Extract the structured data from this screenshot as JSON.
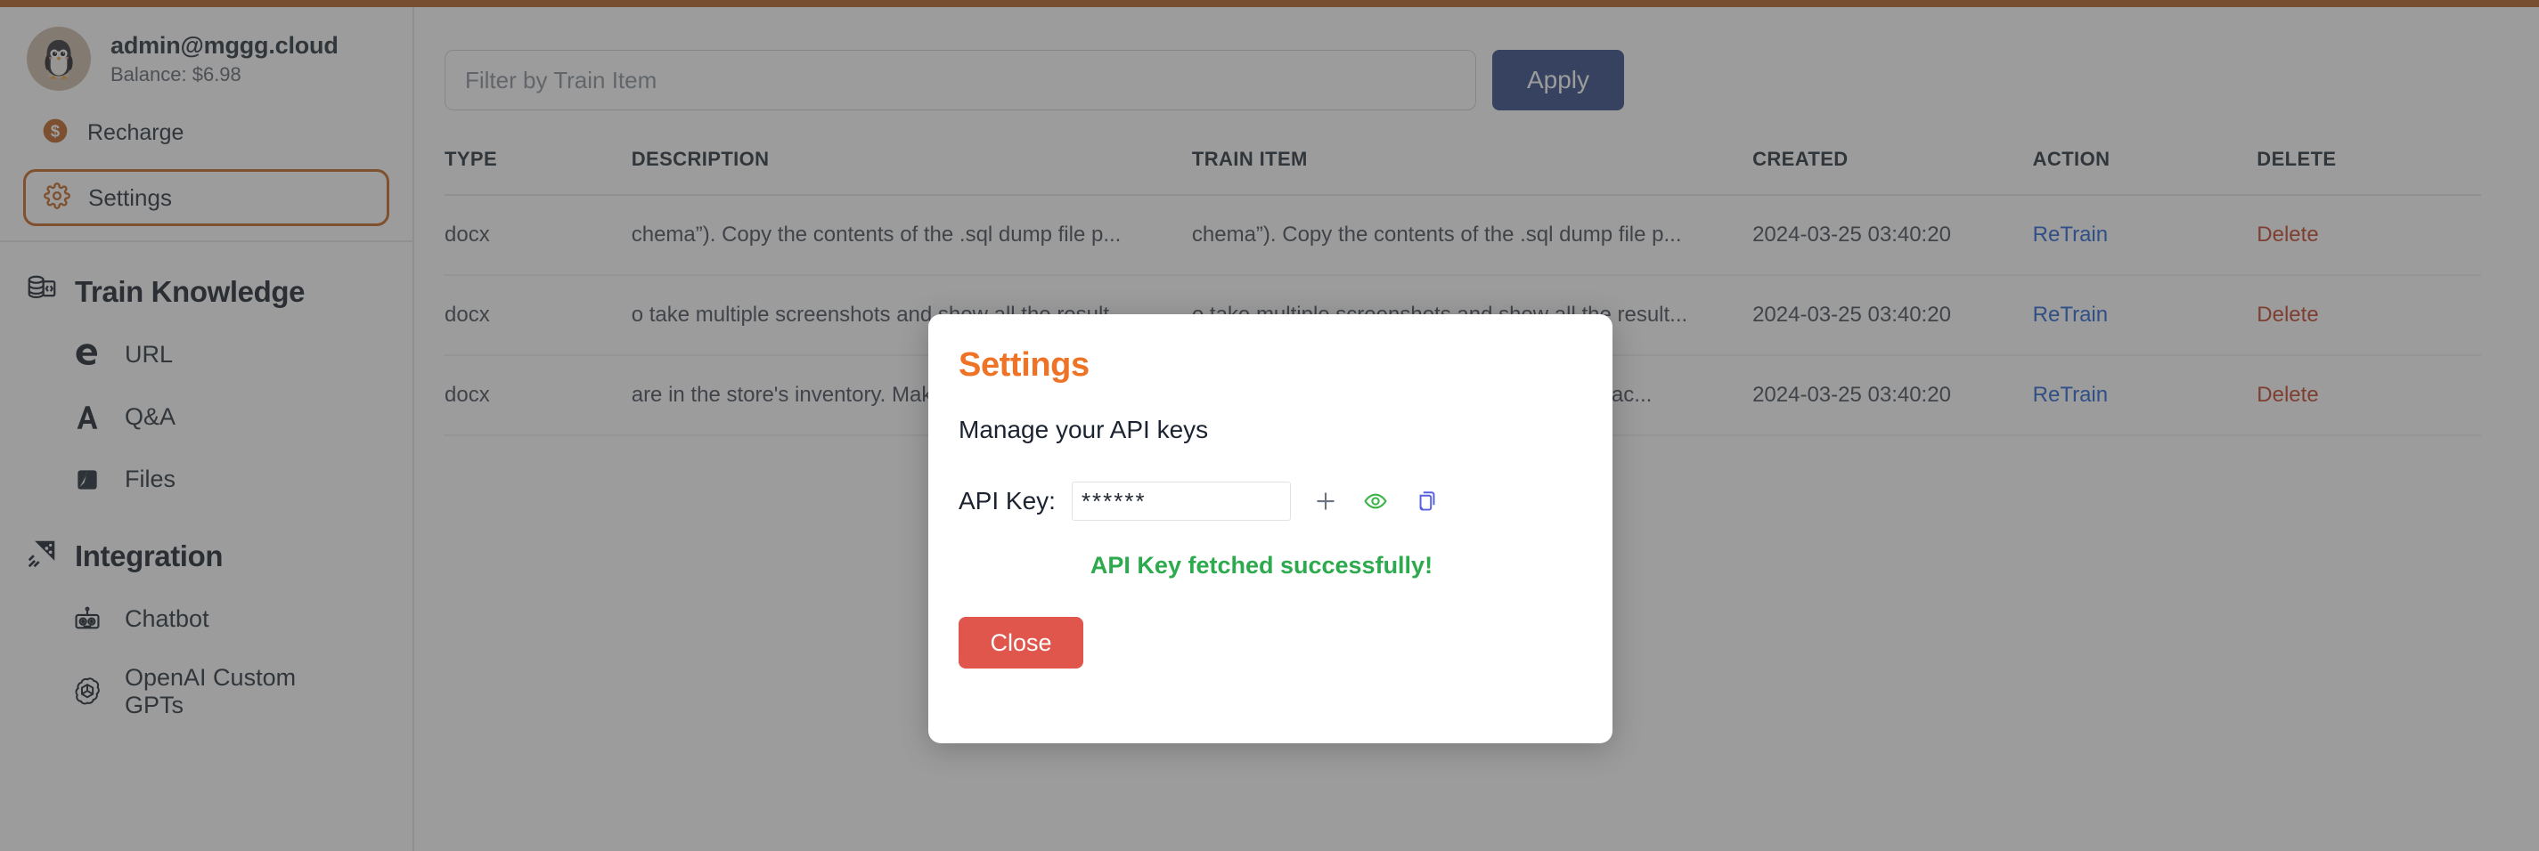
{
  "theme": {
    "accent_orange": "#c2621b",
    "top_bar": "#b15c1e",
    "modal_title_orange": "#ee7326",
    "primary_blue": "#2a4480",
    "link_blue": "#1f5fd4",
    "danger_red": "#c23b22",
    "close_red": "#e0564c",
    "success_green": "#2eaa4e",
    "copy_icon_blue": "#5a61e0"
  },
  "sidebar": {
    "profile": {
      "avatar_icon": "penguin-avatar",
      "email": "admin@mggg.cloud",
      "balance": "Balance: $6.98"
    },
    "recharge": {
      "icon": "dollar-coin-icon",
      "label": "Recharge"
    },
    "settings": {
      "icon": "gear-icon",
      "label": "Settings"
    },
    "sections": [
      {
        "icon": "database-code-icon",
        "title": "Train Knowledge",
        "items": [
          {
            "icon": "edge-e-icon",
            "label": "URL"
          },
          {
            "icon": "letter-a-icon",
            "label": "Q&A"
          },
          {
            "icon": "files-icon",
            "label": "Files"
          }
        ]
      },
      {
        "icon": "integration-kite-icon",
        "title": "Integration",
        "items": [
          {
            "icon": "robot-icon",
            "label": "Chatbot"
          },
          {
            "icon": "openai-icon",
            "label": "OpenAI Custom GPTs"
          }
        ]
      }
    ]
  },
  "main": {
    "filter": {
      "placeholder": "Filter by Train Item",
      "value": "",
      "apply_label": "Apply"
    },
    "table": {
      "columns": [
        "TYPE",
        "DESCRIPTION",
        "TRAIN ITEM",
        "CREATED",
        "ACTION",
        "DELETE"
      ],
      "rows": [
        {
          "type": "docx",
          "description": "chema”). Copy the contents of the .sql dump file p...",
          "train_item": "chema”). Copy the contents of the .sql dump file p...",
          "created": "2024-03-25 03:40:20",
          "action": "ReTrain",
          "delete": "Delete"
        },
        {
          "type": "docx",
          "description": "o take multiple screenshots and show all the result...",
          "train_item": "o take multiple screenshots and show all the result...",
          "created": "2024-03-25 03:40:20",
          "action": "ReTrain",
          "delete": "Delete"
        },
        {
          "type": "docx",
          "description": "are in the store's inventory. Make sure that eac...",
          "train_item": "are in the store's inventory. Make sure that eac...",
          "created": "2024-03-25 03:40:20",
          "action": "ReTrain",
          "delete": "Delete"
        }
      ]
    }
  },
  "modal": {
    "title": "Settings",
    "subtitle": "Manage your API keys",
    "api_key_label": "API Key:",
    "api_key_value": "******",
    "icons": {
      "add": "plus-icon",
      "reveal": "eye-icon",
      "copy": "copy-icon"
    },
    "status_message": "API Key fetched successfully!",
    "close_label": "Close"
  }
}
